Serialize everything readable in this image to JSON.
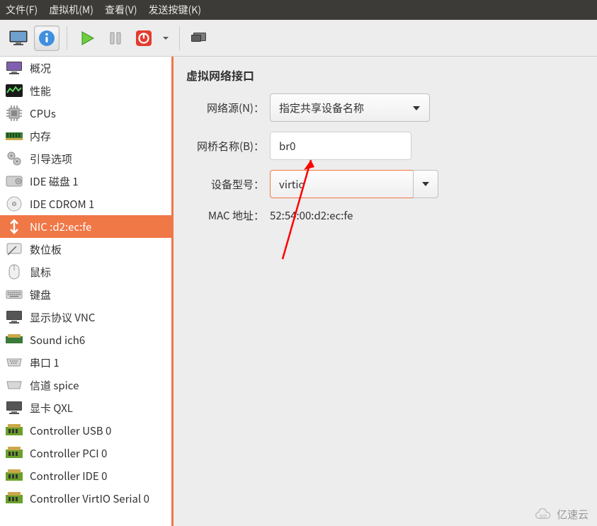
{
  "menu": {
    "file": "文件(F)",
    "vm": "虚拟机(M)",
    "view": "查看(V)",
    "sendkey": "发送按键(K)"
  },
  "sidebar": {
    "items": [
      {
        "label": "概况"
      },
      {
        "label": "性能"
      },
      {
        "label": "CPUs"
      },
      {
        "label": "内存"
      },
      {
        "label": "引导选项"
      },
      {
        "label": "IDE 磁盘 1"
      },
      {
        "label": "IDE CDROM 1"
      },
      {
        "label": "NIC :d2:ec:fe"
      },
      {
        "label": "数位板"
      },
      {
        "label": "鼠标"
      },
      {
        "label": "键盘"
      },
      {
        "label": "显示协议 VNC"
      },
      {
        "label": "Sound ich6"
      },
      {
        "label": "串口 1"
      },
      {
        "label": "信道 spice"
      },
      {
        "label": "显卡 QXL"
      },
      {
        "label": "Controller USB 0"
      },
      {
        "label": "Controller PCI 0"
      },
      {
        "label": "Controller IDE 0"
      },
      {
        "label": "Controller VirtIO Serial 0"
      }
    ]
  },
  "section": {
    "title": "虚拟网络接口"
  },
  "form": {
    "net_source_label": "网络源(N)：",
    "net_source_value": "指定共享设备名称",
    "bridge_label": "网桥名称(B)：",
    "bridge_value": "br0",
    "model_label": "设备型号：",
    "model_value": "virtio",
    "mac_label": "MAC 地址：",
    "mac_value": "52:54:00:d2:ec:fe"
  },
  "watermark": "亿速云"
}
